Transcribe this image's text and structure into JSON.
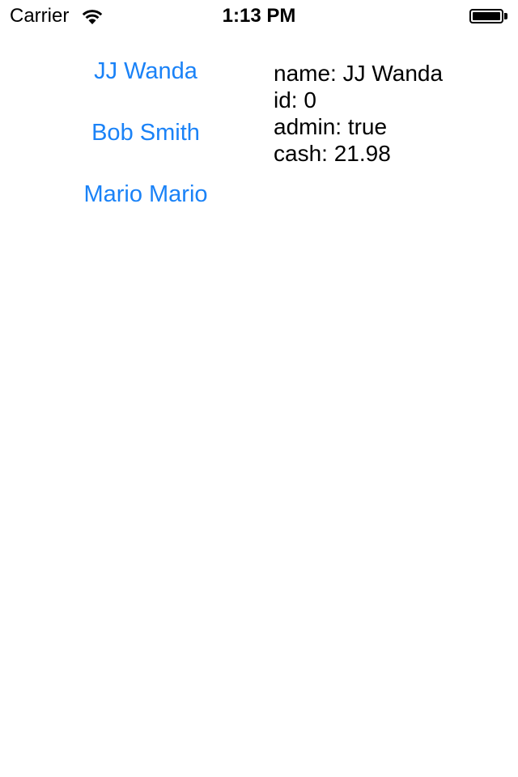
{
  "status_bar": {
    "carrier": "Carrier",
    "time": "1:13 PM",
    "wifi_icon": "wifi-icon",
    "battery_icon": "battery-icon",
    "battery_level": 1.0
  },
  "users": [
    {
      "label": "JJ Wanda"
    },
    {
      "label": "Bob Smith"
    },
    {
      "label": "Mario Mario"
    }
  ],
  "details": {
    "name": "name: JJ Wanda",
    "id": "id: 0",
    "admin": "admin: true",
    "cash": "cash: 21.98"
  },
  "colors": {
    "link": "#1a82f7",
    "text": "#000000",
    "background": "#ffffff"
  }
}
